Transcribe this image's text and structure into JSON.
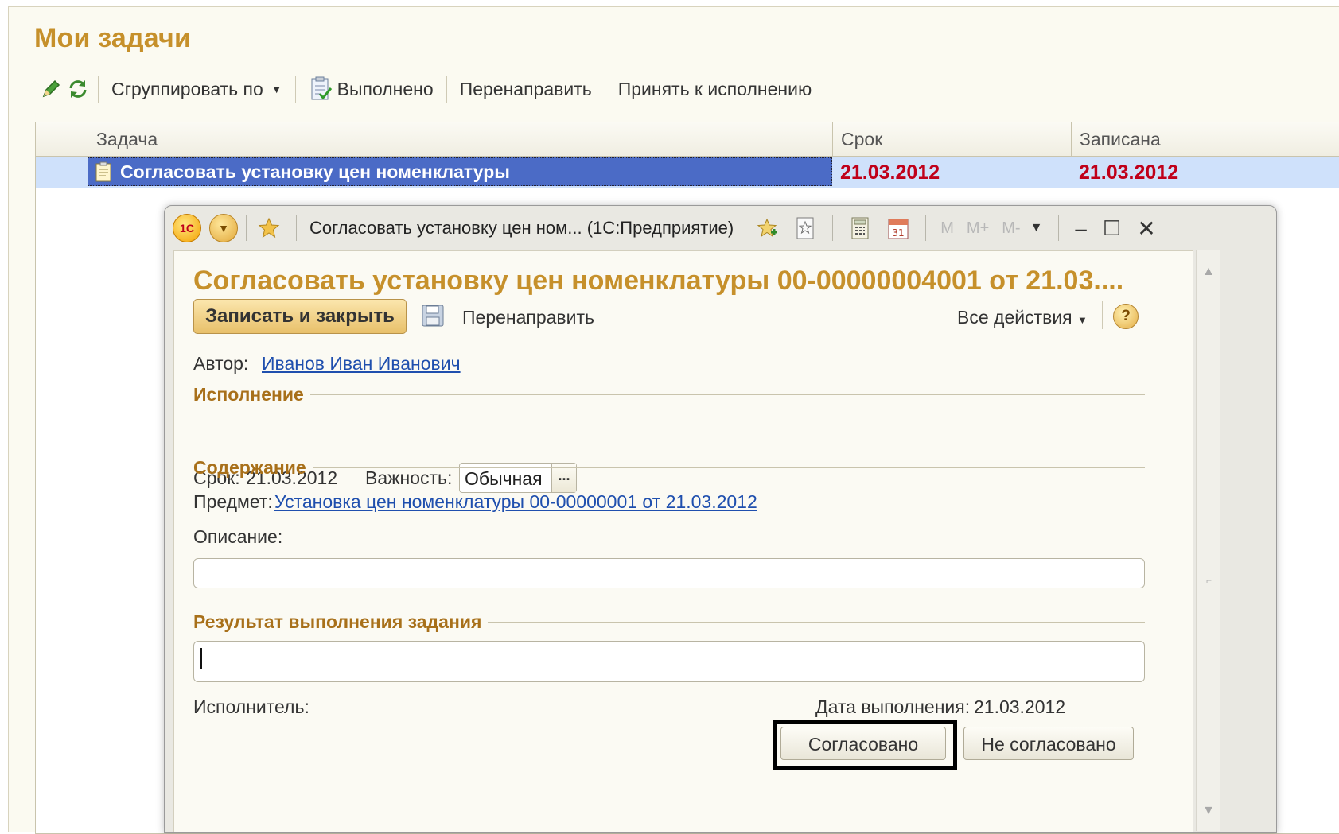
{
  "main": {
    "title": "Мои задачи",
    "toolbar": {
      "group_by": "Сгруппировать по",
      "done": "Выполнено",
      "redirect": "Перенаправить",
      "accept": "Принять к исполнению"
    },
    "grid": {
      "columns": [
        "Задача",
        "Срок",
        "Записана"
      ],
      "rows": [
        {
          "task": "Согласовать установку цен номенклатуры",
          "due": "21.03.2012",
          "recorded": "21.03.2012"
        }
      ]
    }
  },
  "window": {
    "title": "Согласовать установку цен ном...  (1С:Предприятие)",
    "logo_text": "1С",
    "memory_buttons": [
      "M",
      "M+",
      "M-"
    ],
    "doc_title": "Согласовать установку цен номенклатуры 00-00000004001 от 21.03....",
    "toolbar": {
      "save_close": "Записать и закрыть",
      "redirect": "Перенаправить",
      "all_actions": "Все действия"
    },
    "author_label": "Автор:",
    "author_value": "Иванов Иван Иванович",
    "section_execution": "Исполнение",
    "due_label": "Срок:",
    "due_value": "21.03.2012",
    "importance_label": "Важность:",
    "importance_value": "Обычная",
    "section_content": "Содержание",
    "subject_label": "Предмет:",
    "subject_value": "Установка цен номенклатуры 00-00000001 от 21.03.2012",
    "description_label": "Описание:",
    "description_value": "",
    "section_result": "Результат выполнения задания",
    "result_value": "",
    "executor_label": "Исполнитель:",
    "completion_date_label": "Дата выполнения:",
    "completion_date_value": "21.03.2012",
    "approve_button": "Согласовано",
    "reject_button": "Не согласовано"
  },
  "colors": {
    "accent_title": "#c6902b",
    "section_title": "#a8701a",
    "selected_row": "#4b6bc6",
    "date_red": "#c0001a",
    "link": "#1f4fae"
  }
}
